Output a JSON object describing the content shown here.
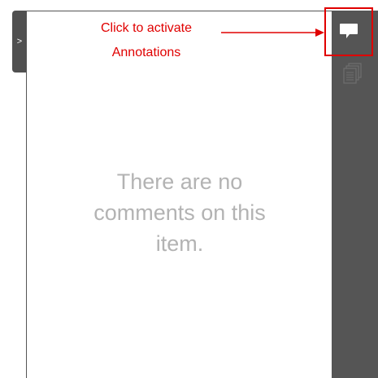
{
  "collapse_tab": {
    "label": ">"
  },
  "comments_panel": {
    "empty_message": "There are no comments on this item."
  },
  "callout": {
    "line1": "Click to activate",
    "line2": "Annotations",
    "color": "#e00000"
  },
  "toolbar": {
    "annotations_button": {
      "icon": "speech-bubble-icon"
    },
    "pages_button": {
      "icon": "stacked-pages-icon"
    }
  }
}
